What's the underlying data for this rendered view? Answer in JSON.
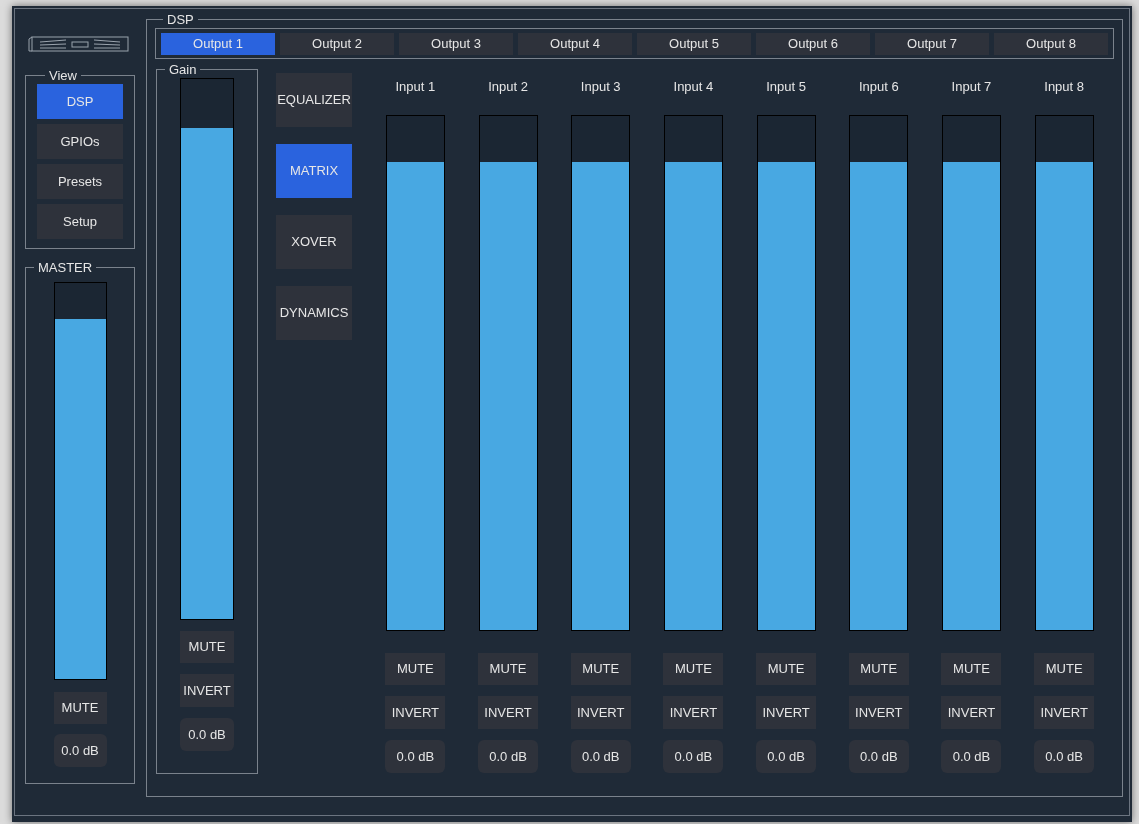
{
  "view": {
    "title": "View",
    "items": [
      {
        "label": "DSP",
        "selected": true
      },
      {
        "label": "GPIOs",
        "selected": false
      },
      {
        "label": "Presets",
        "selected": false
      },
      {
        "label": "Setup",
        "selected": false
      }
    ]
  },
  "master": {
    "title": "MASTER",
    "level": 0.91,
    "mute": "MUTE",
    "value": "0.0 dB"
  },
  "dsp": {
    "title": "DSP",
    "outputs": [
      {
        "label": "Output 1",
        "selected": true
      },
      {
        "label": "Output 2",
        "selected": false
      },
      {
        "label": "Output 3",
        "selected": false
      },
      {
        "label": "Output 4",
        "selected": false
      },
      {
        "label": "Output 5",
        "selected": false
      },
      {
        "label": "Output 6",
        "selected": false
      },
      {
        "label": "Output 7",
        "selected": false
      },
      {
        "label": "Output 8",
        "selected": false
      }
    ],
    "gain": {
      "title": "Gain",
      "level": 0.91,
      "mute": "MUTE",
      "invert": "INVERT",
      "value": "0.0 dB"
    },
    "modes": [
      {
        "label": "EQUALIZER",
        "selected": false
      },
      {
        "label": "MATRIX",
        "selected": true
      },
      {
        "label": "XOVER",
        "selected": false
      },
      {
        "label": "DYNAMICS",
        "selected": false
      }
    ],
    "inputs": [
      {
        "label": "Input 1",
        "level": 0.91,
        "mute": "MUTE",
        "invert": "INVERT",
        "value": "0.0 dB"
      },
      {
        "label": "Input 2",
        "level": 0.91,
        "mute": "MUTE",
        "invert": "INVERT",
        "value": "0.0 dB"
      },
      {
        "label": "Input 3",
        "level": 0.91,
        "mute": "MUTE",
        "invert": "INVERT",
        "value": "0.0 dB"
      },
      {
        "label": "Input 4",
        "level": 0.91,
        "mute": "MUTE",
        "invert": "INVERT",
        "value": "0.0 dB"
      },
      {
        "label": "Input 5",
        "level": 0.91,
        "mute": "MUTE",
        "invert": "INVERT",
        "value": "0.0 dB"
      },
      {
        "label": "Input 6",
        "level": 0.91,
        "mute": "MUTE",
        "invert": "INVERT",
        "value": "0.0 dB"
      },
      {
        "label": "Input 7",
        "level": 0.91,
        "mute": "MUTE",
        "invert": "INVERT",
        "value": "0.0 dB"
      },
      {
        "label": "Input 8",
        "level": 0.91,
        "mute": "MUTE",
        "invert": "INVERT",
        "value": "0.0 dB"
      }
    ]
  }
}
